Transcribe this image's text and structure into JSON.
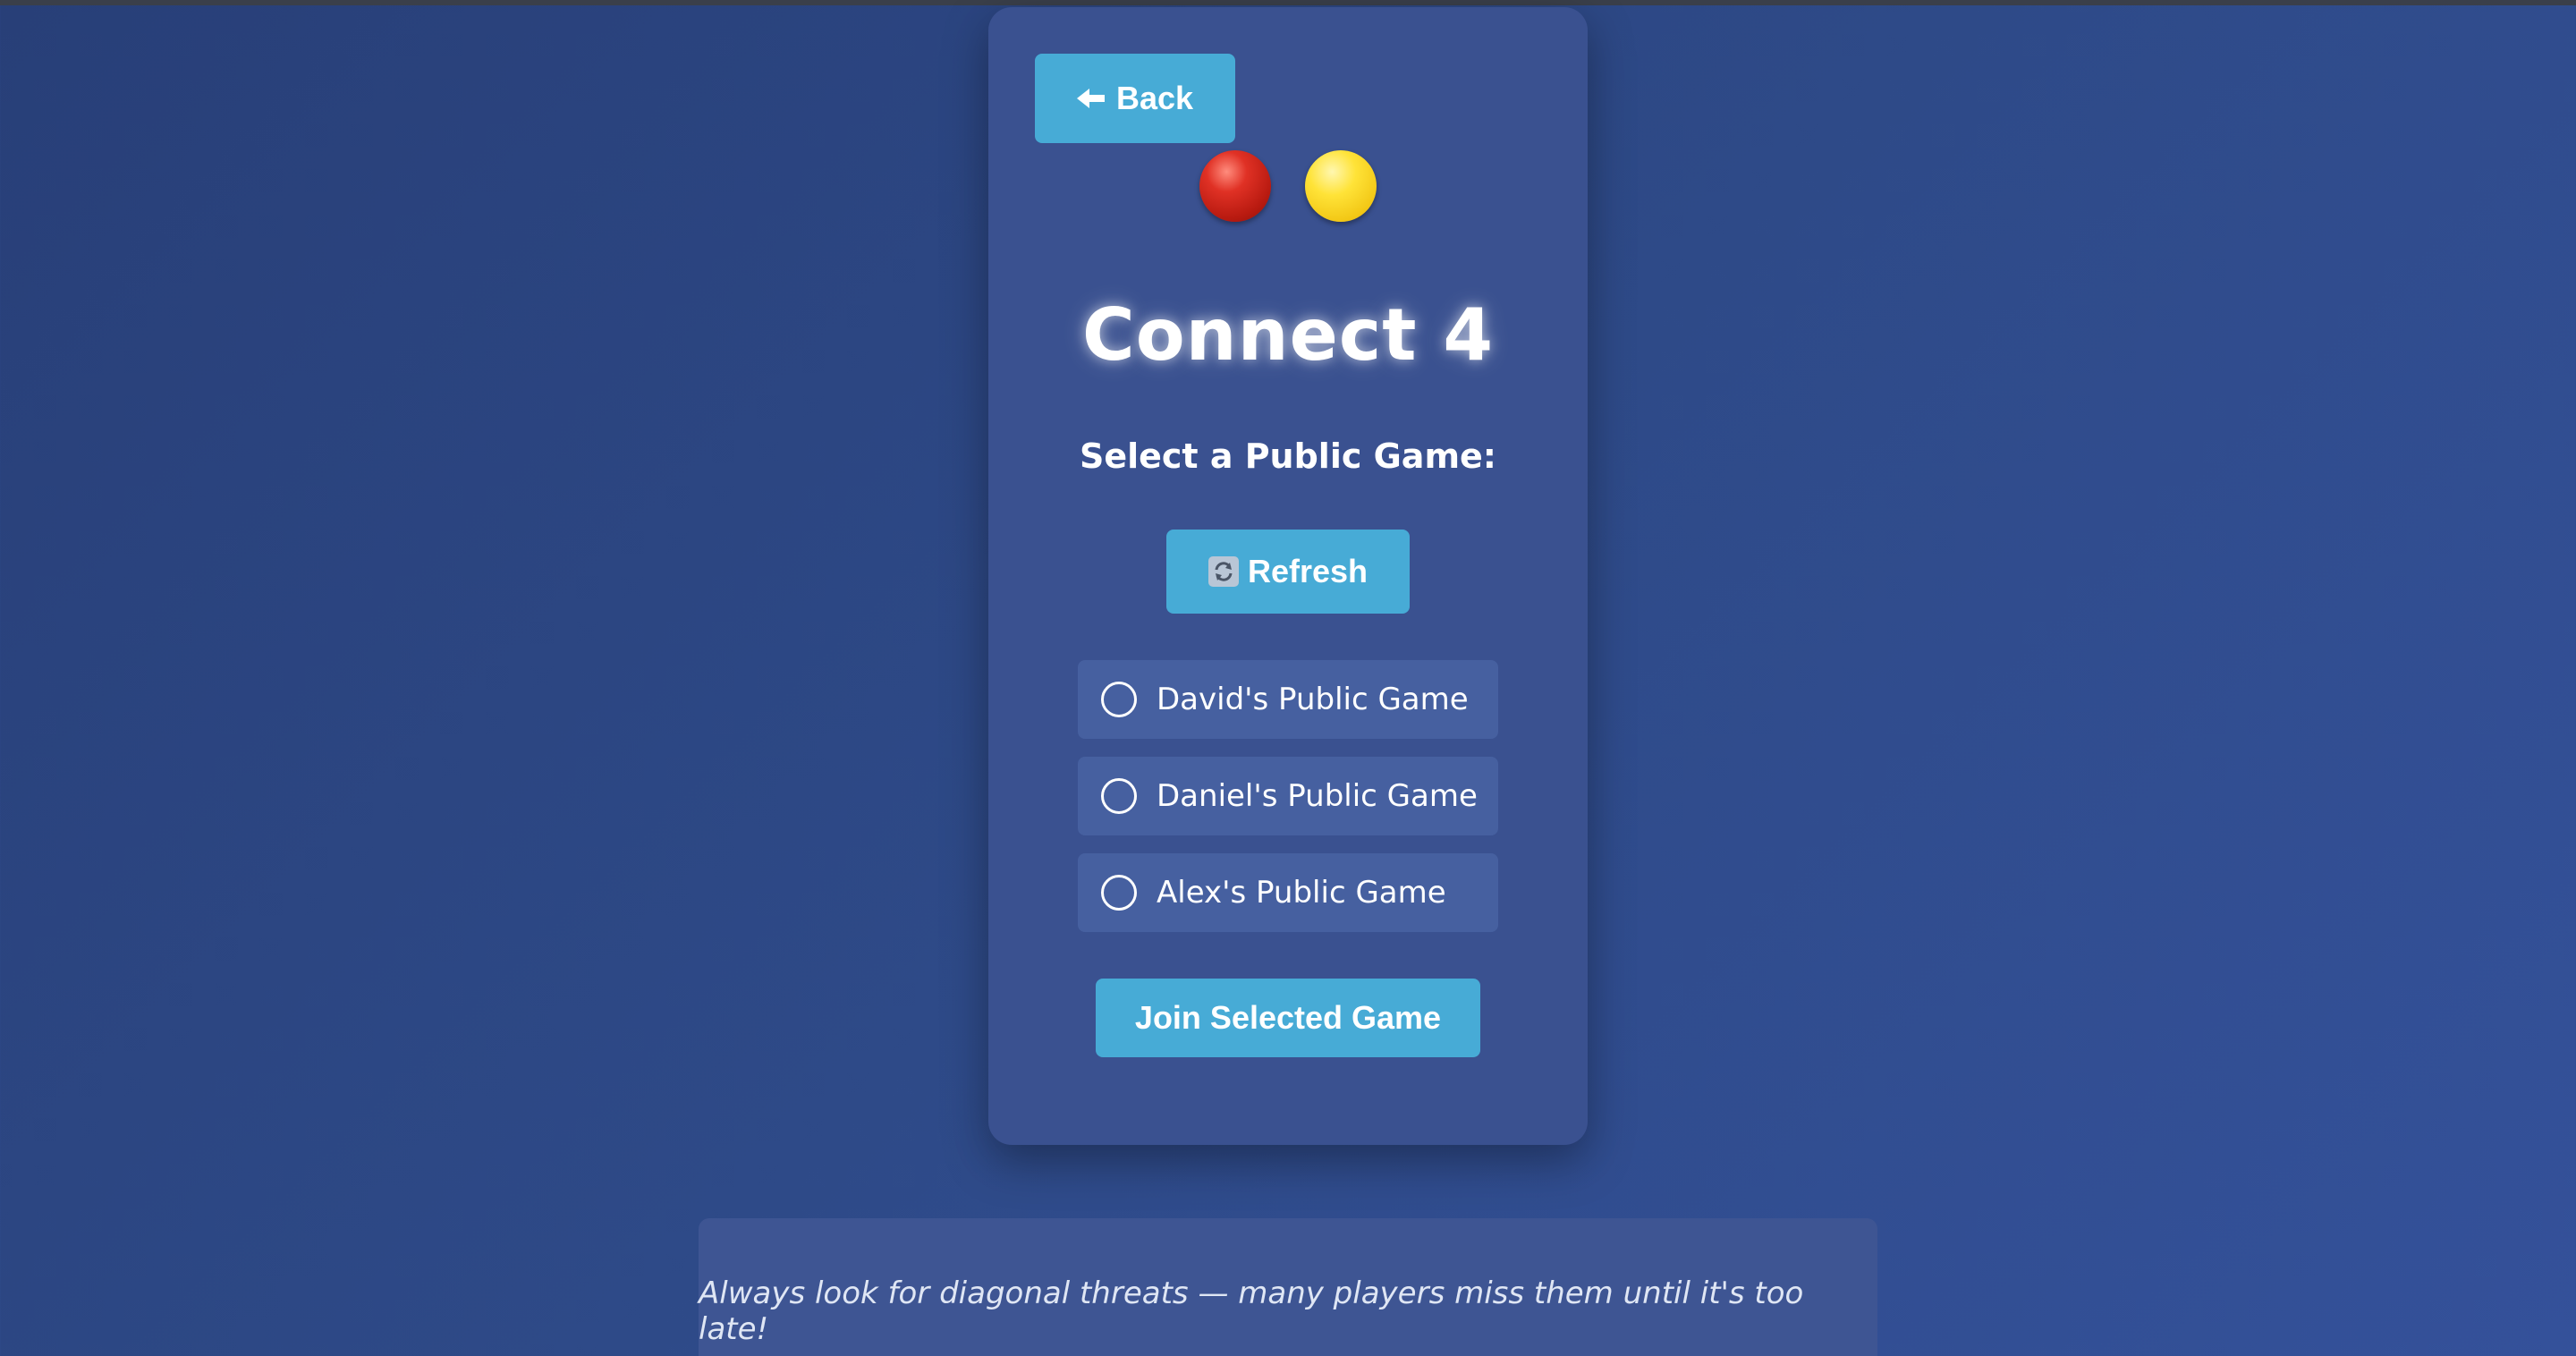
{
  "colors": {
    "background": "#2e4a88",
    "card": "#3a5190",
    "accent_button": "#47abd6",
    "game_item": "#4660a0",
    "red_disc": "#d22a1e",
    "yellow_disc": "#ffe338"
  },
  "nav": {
    "back_label": "Back",
    "back_icon": "arrow-left-icon"
  },
  "header": {
    "discs": [
      "red-disc-icon",
      "yellow-disc-icon"
    ],
    "title": "Connect 4",
    "subtitle": "Select a Public Game:"
  },
  "actions": {
    "refresh_label": "Refresh",
    "refresh_icon": "refresh-icon",
    "join_label": "Join Selected Game"
  },
  "games": [
    {
      "label": "David's Public Game",
      "selected": false
    },
    {
      "label": "Daniel's Public Game",
      "selected": false
    },
    {
      "label": "Alex's Public Game",
      "selected": false
    }
  ],
  "tip": {
    "text": "Always look for diagonal threats — many players miss them until it's too late!"
  }
}
